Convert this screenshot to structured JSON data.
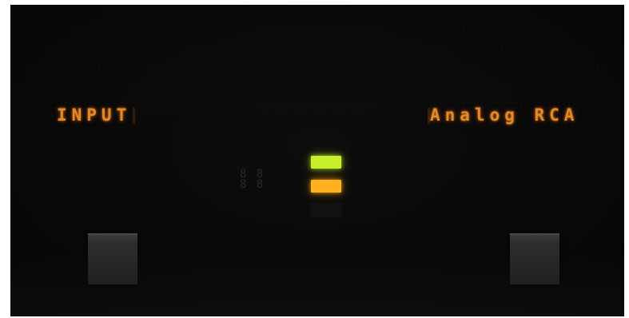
{
  "display": {
    "left_text": "INPUT",
    "right_text": "Analog RCA",
    "text_color": "#e08a2a"
  },
  "indicators": {
    "top_led_color": "#c8f02a",
    "middle_led_color": "#ffb21e",
    "bottom_led_color": "#121212"
  },
  "controls": {
    "left_button_icon": "square-button",
    "right_button_icon": "square-button"
  }
}
